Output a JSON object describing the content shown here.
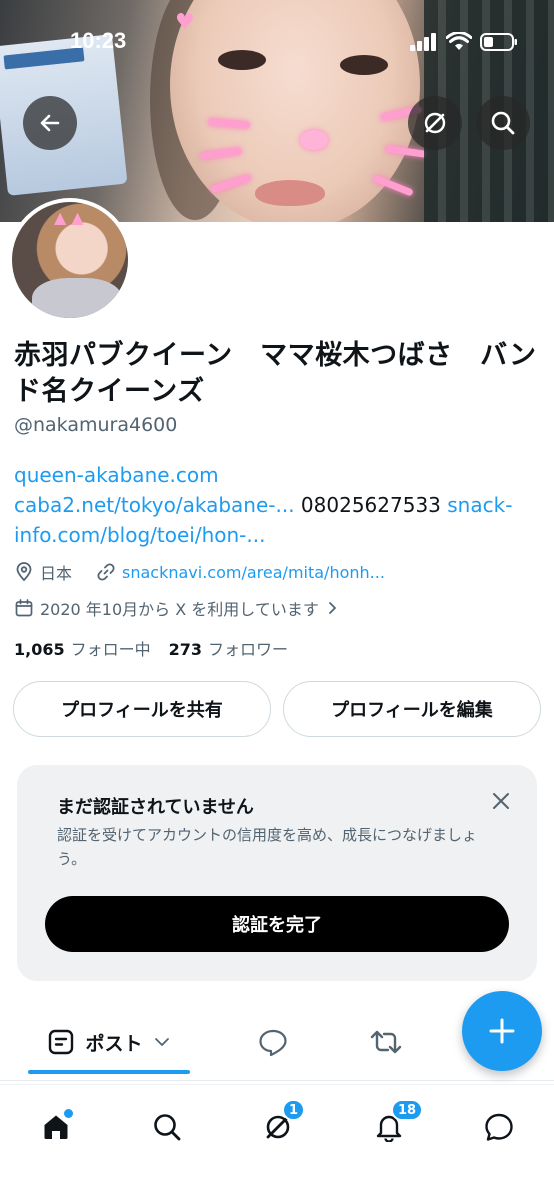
{
  "status_bar": {
    "time": "10:23"
  },
  "profile": {
    "display_name": "赤羽パブクイーン　ママ桜木つばさ　バンド名クイーンズ",
    "handle": "@nakamura4600",
    "bio": {
      "link1": "queen-akabane.com",
      "link2": "caba2.net/tokyo/akabane-...",
      "phone": " 08025627533 ",
      "link3": "snack-info.com/blog/toei/hon-..."
    },
    "location": "日本",
    "website": "snacknavi.com/area/mita/honh...",
    "joined": "2020 年10月から X を利用しています",
    "following_count": "1,065",
    "following_label": "フォロー中",
    "followers_count": "273",
    "followers_label": "フォロワー"
  },
  "actions": {
    "share_label": "プロフィールを共有",
    "edit_label": "プロフィールを編集"
  },
  "verification": {
    "title": "まだ認証されていません",
    "description": "認証を受けてアカウントの信用度を高め、成長につなげましょう。",
    "cta_label": "認証を完了"
  },
  "tabs": {
    "posts_label": "ポスト"
  },
  "bottom_nav": {
    "communities_badge": "1",
    "notifications_badge": "18"
  },
  "colors": {
    "accent": "#1d9bf0",
    "text_primary": "#0f1419",
    "text_secondary": "#536471"
  },
  "icons": [
    "back-arrow-icon",
    "grok-icon",
    "search-icon",
    "location-pin-icon",
    "link-icon",
    "calendar-icon",
    "chevron-right-icon",
    "close-icon",
    "posts-icon",
    "chevron-down-icon",
    "reply-icon",
    "repost-icon",
    "plus-icon",
    "home-icon",
    "communities-icon",
    "bell-icon",
    "messages-icon",
    "signal-icon",
    "wifi-icon",
    "battery-icon"
  ]
}
